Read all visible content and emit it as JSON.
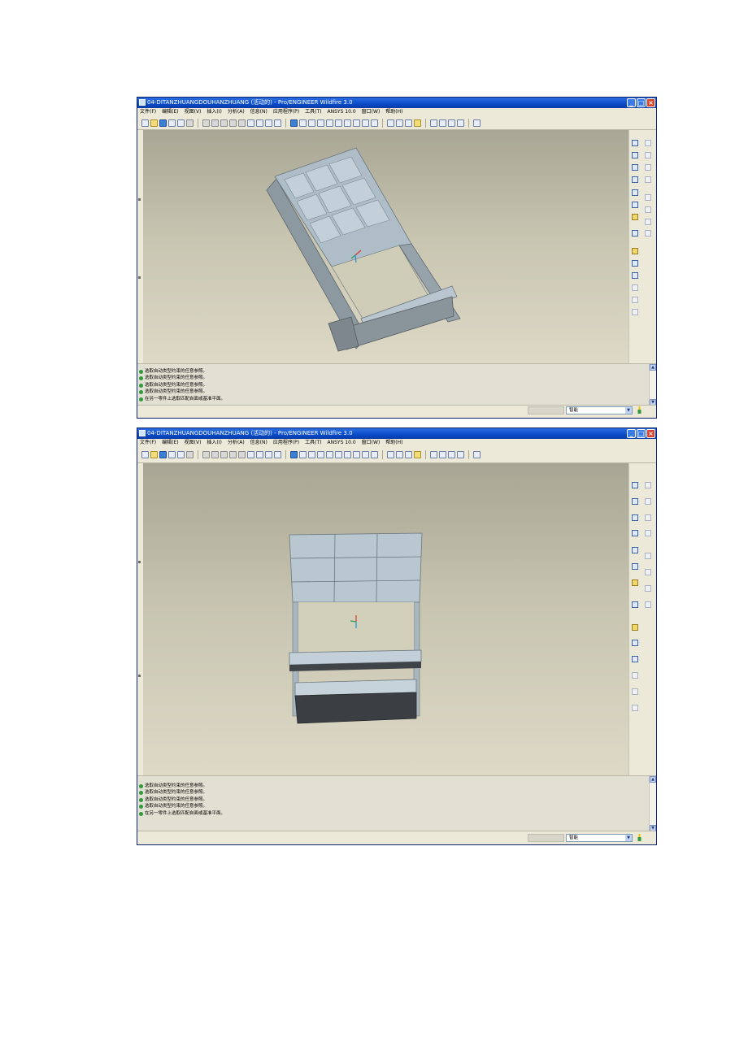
{
  "windows": [
    {
      "title": "04-DITANZHUANGDOUHANZHUANG (活动的) - Pro/ENGINEER Wildfire 3.0",
      "menu": [
        "文件(F)",
        "编辑(E)",
        "视图(V)",
        "插入(I)",
        "分析(A)",
        "信息(N)",
        "应用程序(P)",
        "工具(T)",
        "ANSYS 10.0",
        "窗口(W)",
        "帮助(H)"
      ],
      "messages": [
        "选取自动类型约束的任意参照。",
        "选取自动类型约束的任意参照。",
        "选取自动类型约束的任意参照。",
        "选取自动类型约束的任意参照。",
        "在另一零件上选取匹配自面或基准平面。"
      ],
      "filter_value": "智能"
    },
    {
      "title": "04-DITANZHUANGDOUHANZHUANG (活动的) - Pro/ENGINEER Wildfire 3.0",
      "menu": [
        "文件(F)",
        "编辑(E)",
        "视图(V)",
        "插入(I)",
        "分析(A)",
        "信息(N)",
        "应用程序(P)",
        "工具(T)",
        "ANSYS 10.0",
        "窗口(W)",
        "帮助(H)"
      ],
      "messages": [
        "选取自动类型约束的任意参照。",
        "选取自动类型约束的任意参照。",
        "选取自动类型约束的任意参照。",
        "选取自动类型约束的任意参照。",
        "在另一零件上选取匹配自面或基准平面。"
      ],
      "filter_value": "智能"
    }
  ],
  "icons": {
    "minimize": "minimize-icon",
    "restore": "restore-icon",
    "close": "close-icon",
    "message_bullet": "message-bullet-icon",
    "filter": "filter-icon"
  },
  "colors": {
    "titlebar": "#0a4bc9",
    "model_body": "#b4c3cd",
    "model_dark": "#3c4044",
    "viewport_top": "#a8a694",
    "viewport_bottom": "#ddd9c6"
  }
}
